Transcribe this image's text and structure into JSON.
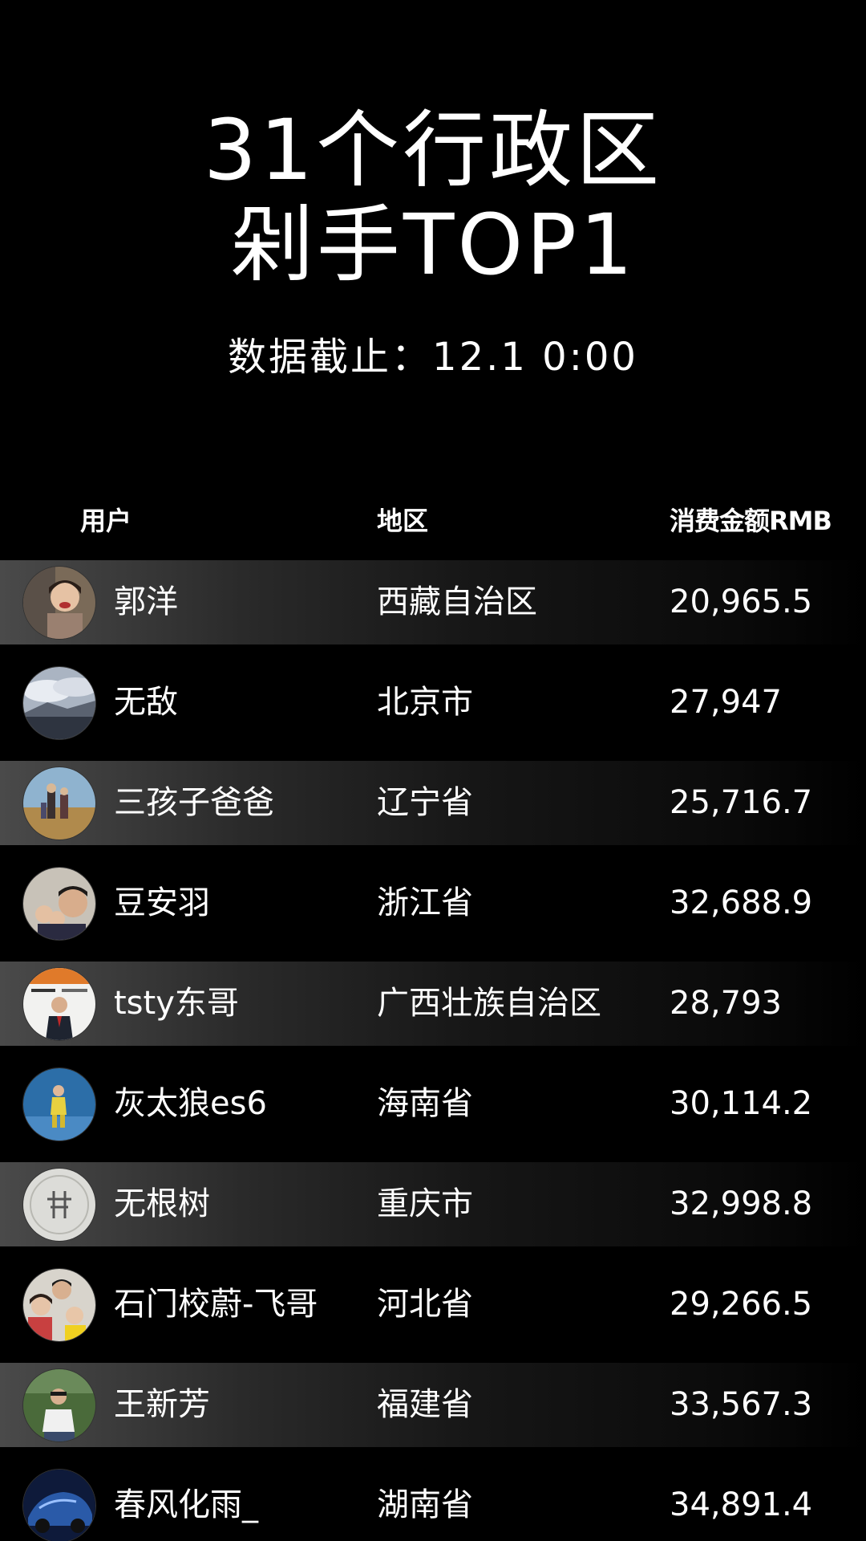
{
  "title": {
    "line1": "31个行政区",
    "line2": "剁手TOP1"
  },
  "subtitle": "数据截止：12.1 0:00",
  "table": {
    "headers": {
      "user": "用户",
      "region": "地区",
      "amount": "消费金额RMB"
    },
    "rows": [
      {
        "name": "郭洋",
        "region": "西藏自治区",
        "amount": "20,965.5",
        "avatar": "photo-girl-icon",
        "shaded": true
      },
      {
        "name": "无敌",
        "region": "北京市",
        "amount": "27,947",
        "avatar": "landscape-sky-icon",
        "shaded": false
      },
      {
        "name": "三孩子爸爸",
        "region": "辽宁省",
        "amount": "25,716.7",
        "avatar": "family-field-icon",
        "shaded": true
      },
      {
        "name": "豆安羽",
        "region": "浙江省",
        "amount": "32,688.9",
        "avatar": "family-selfie-icon",
        "shaded": false
      },
      {
        "name": "tsty东哥",
        "region": "广西壮族自治区",
        "amount": "28,793",
        "avatar": "man-suit-icon",
        "shaded": true
      },
      {
        "name": "灰太狼es6",
        "region": "海南省",
        "amount": "30,114.2",
        "avatar": "child-blue-icon",
        "shaded": false
      },
      {
        "name": "无根树",
        "region": "重庆市",
        "amount": "32,998.8",
        "avatar": "seal-logo-icon",
        "shaded": true
      },
      {
        "name": "石门校蔚-飞哥",
        "region": "河北省",
        "amount": "29,266.5",
        "avatar": "family-group-icon",
        "shaded": false
      },
      {
        "name": "王新芳",
        "region": "福建省",
        "amount": "33,567.3",
        "avatar": "man-outdoor-icon",
        "shaded": true
      },
      {
        "name": "春风化雨_",
        "region": "湖南省",
        "amount": "34,891.4",
        "avatar": "car-blue-icon",
        "shaded": false
      }
    ]
  }
}
